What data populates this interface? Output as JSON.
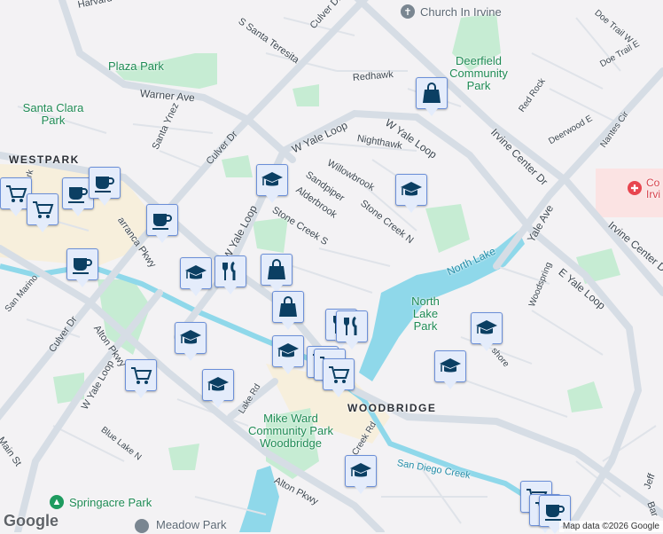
{
  "streets": {
    "harvard": "Harvard",
    "s_santa_teresita": "S Santa Teresita",
    "culver_dr_top": "Culver Dr",
    "culver_dr_mid": "Culver Dr",
    "culver_dr_low": "Culver Dr",
    "warner_ave": "Warner Ave",
    "santa_ynez": "Santa Ynez",
    "w_yale_loop_top": "W Yale Loop",
    "w_yale_loop_mid": "W Yale Loop",
    "w_yale_loop_left": "W Yale Loop",
    "w_yale_loop_low": "W Yale Loop",
    "sandpiper": "Sandpiper",
    "alderbrook": "Alderbrook",
    "willowbrook": "Willowbrook",
    "stone_creek_s": "Stone Creek S",
    "stone_creek_n": "Stone Creek N",
    "nighthawk": "Nighthawk",
    "redhawk": "Redhawk",
    "irvine_center_dr": "Irvine Center Dr",
    "irvine_center_dr_2": "Irvine Center D",
    "yale_ave": "Yale Ave",
    "red_rock": "Red Rock",
    "deerwood_e": "Deerwood E",
    "nantes_cir": "Nantes Cir",
    "doe_trail_w": "Doe Trail W",
    "doe_trail_e": "Doe Trail E",
    "e_yale_loop": "E Yale Loop",
    "woodspring": "Woodspring",
    "shore": "shore",
    "barranca": "arranca Pkwy",
    "westpark_st": "park",
    "san_marino": "San Marino",
    "alton_pkwy": "Alton Pkwy",
    "alton_pkwy_2": "Alton Pkwy",
    "blue_lake_n": "Blue Lake N",
    "lake_rd": "Lake Rd",
    "main_st": "Main St",
    "creek_rd": "Creek Rd",
    "jeff": "Jeff",
    "bar": "Bar"
  },
  "places": {
    "plaza_park": "Plaza Park",
    "santa_clara_park": "Santa Clara Park",
    "westpark": "WESTPARK",
    "woodbridge": "WOODBRIDGE",
    "church": "Church In Irvine",
    "deerfield_park": "Deerfield Community Park",
    "north_lake_park": "North Lake Park",
    "north_lake": "North Lake",
    "mike_ward_park": "Mike Ward Community Park Woodbridge",
    "san_diego_creek": "San Diego Creek",
    "springacre_park": "Springacre Park",
    "meadow_park": "Meadow Park",
    "hospital": "Co Irvi"
  },
  "attribution": "Map data ©2026 Google",
  "logo": "Google",
  "colors": {
    "marker_bg": "#e4ecfb",
    "marker_icon": "#0b3f63",
    "park": "#c6ecd3",
    "water": "#8fd8ea",
    "road": "#d6dde5",
    "commercial": "#f7efdc"
  }
}
